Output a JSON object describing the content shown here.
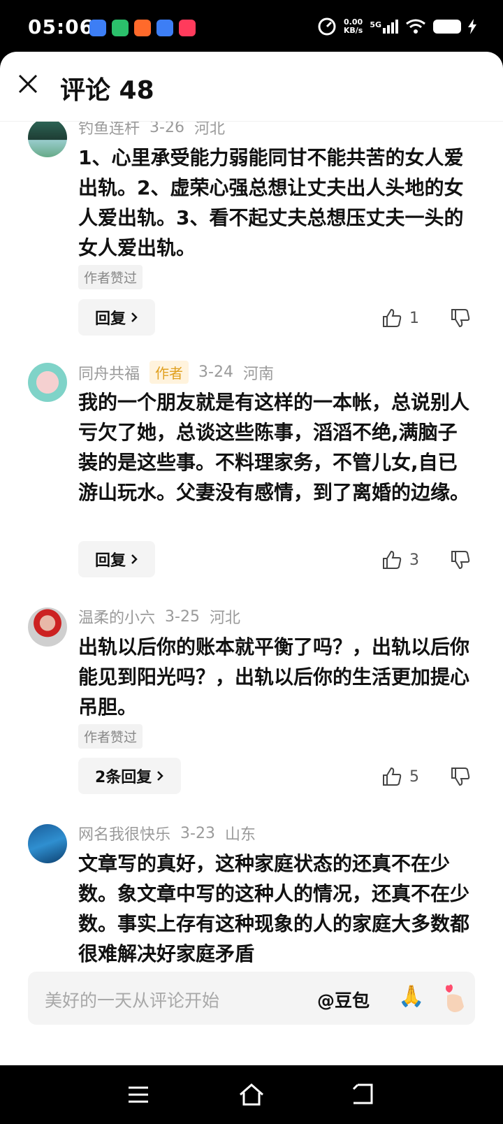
{
  "status": {
    "time": "05:06",
    "speed_value": "0.00",
    "speed_unit": "KB/s",
    "network": "5G"
  },
  "header": {
    "title": "评论 48"
  },
  "comments": [
    {
      "user": "钓鱼连杆",
      "date": "3-26",
      "region": "河北",
      "text": "1、心里承受能力弱能同甘不能共苦的女人爱出轨。2、虚荣心强总想让丈夫出人头地的女人爱出轨。3、看不起丈夫总想压丈夫一头的女人爱出轨。",
      "liked_tag": "作者赞过",
      "reply_label": "回复",
      "likes": "1"
    },
    {
      "user": "同舟共福",
      "author_tag": "作者",
      "date": "3-24",
      "region": "河南",
      "text": "我的一个朋友就是有这样的一本帐，总说别人亏欠了她，总谈这些陈事，滔滔不绝,满脑子装的是这些事。不料理家务，不管儿女,自已游山玩水。父妻没有感情，到了离婚的边缘。",
      "reply_label": "回复",
      "likes": "3"
    },
    {
      "user": "温柔的小六",
      "date": "3-25",
      "region": "河北",
      "text": "出轨以后你的账本就平衡了吗？，出轨以后你能见到阳光吗？，出轨以后你的生活更加提心吊胆。",
      "liked_tag": "作者赞过",
      "reply_label": "2条回复",
      "likes": "5"
    },
    {
      "user": "网名我很快乐",
      "date": "3-23",
      "region": "山东",
      "text": "文章写的真好，这种家庭状态的还真不在少数。象文章中写的这种人的情况，还真不在少数。事实上存有这种现象的人的家庭大多数都很难解决好家庭矛盾"
    }
  ],
  "input": {
    "placeholder": "美好的一天从评论开始",
    "mention": "@豆包",
    "emoji_pray": "🙏",
    "emoji_heart": "heart-hand-icon"
  },
  "colors": {
    "author_tag_bg": "#fff3dd",
    "author_tag_text": "#e0a020"
  }
}
